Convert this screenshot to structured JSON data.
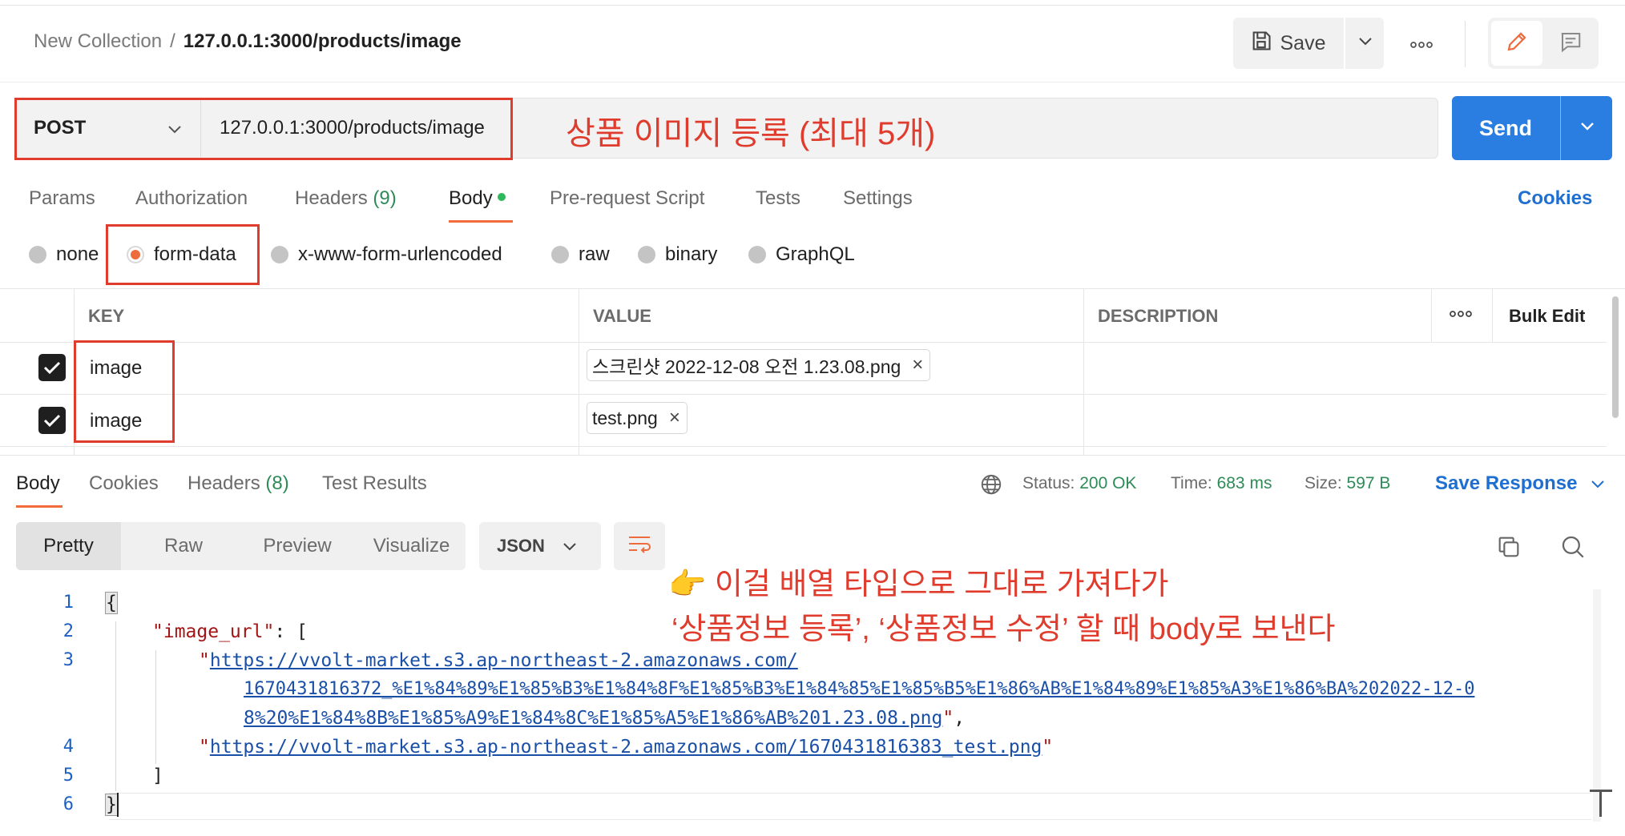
{
  "header": {
    "collection": "New Collection",
    "separator": "/",
    "request_name": "127.0.0.1:3000/products/image",
    "save_label": "Save",
    "more_icon": "more-horizontal-icon"
  },
  "request": {
    "method": "POST",
    "url": "127.0.0.1:3000/products/image",
    "annotation": "상품 이미지 등록 (최대 5개)",
    "send_label": "Send"
  },
  "request_tabs": [
    {
      "label": "Params"
    },
    {
      "label": "Authorization"
    },
    {
      "label": "Headers",
      "count": "(9)"
    },
    {
      "label": "Body"
    },
    {
      "label": "Pre-request Script"
    },
    {
      "label": "Tests"
    },
    {
      "label": "Settings"
    }
  ],
  "cookies_label": "Cookies",
  "body_types": [
    "none",
    "form-data",
    "x-www-form-urlencoded",
    "raw",
    "binary",
    "GraphQL"
  ],
  "body_type_selected": "form-data",
  "form_table": {
    "headers": {
      "key": "KEY",
      "value": "VALUE",
      "description": "DESCRIPTION",
      "bulk_edit": "Bulk Edit"
    },
    "rows": [
      {
        "checked": true,
        "key": "image",
        "value": "스크린샷 2022-12-08 오전 1.23.08.png",
        "remove": "×"
      },
      {
        "checked": true,
        "key": "image",
        "value": "test.png",
        "remove": "×"
      }
    ]
  },
  "response_tabs": [
    {
      "label": "Body"
    },
    {
      "label": "Cookies"
    },
    {
      "label": "Headers",
      "count": "(8)"
    },
    {
      "label": "Test Results"
    }
  ],
  "response_status": {
    "status_label": "Status:",
    "status_value": "200 OK",
    "time_label": "Time:",
    "time_value": "683 ms",
    "size_label": "Size:",
    "size_value": "597 B"
  },
  "save_response_label": "Save Response",
  "view_modes": [
    "Pretty",
    "Raw",
    "Preview",
    "Visualize"
  ],
  "format": "JSON",
  "annotation2": {
    "line1": "👉 이걸 배열 타입으로 그대로 가져다가",
    "line2": "‘상품정보 등록’, ‘상품정보 수정’ 할 때 body로 보낸다"
  },
  "code": {
    "line_numbers": [
      "1",
      "2",
      "3",
      "4",
      "5",
      "6"
    ],
    "open_brace": "{",
    "key": "\"image_url\"",
    "colon_bracket": ": [",
    "url1_a": "https://vvolt-market.s3.ap-northeast-2.amazonaws.com/",
    "url1_b": "1670431816372_%E1%84%89%E1%85%B3%E1%84%8F%E1%85%B3%E1%84%85%E1%85%B5%E1%86%AB%E1%84%89%E1%85%A3%E1%86%BA%202022-12-0",
    "url1_c": "8%20%E1%84%8B%E1%85%A9%E1%84%8C%E1%85%A5%E1%86%AB%201.23.08.png",
    "url2": "https://vvolt-market.s3.ap-northeast-2.amazonaws.com/1670431816383_test.png",
    "close_bracket": "]",
    "close_brace": "}"
  },
  "colors": {
    "accent_orange": "#f26b3a",
    "send_blue": "#2a7de1",
    "link_blue": "#1f6fd1",
    "status_green": "#2e8b57",
    "annotation_red": "#e03c2e"
  }
}
